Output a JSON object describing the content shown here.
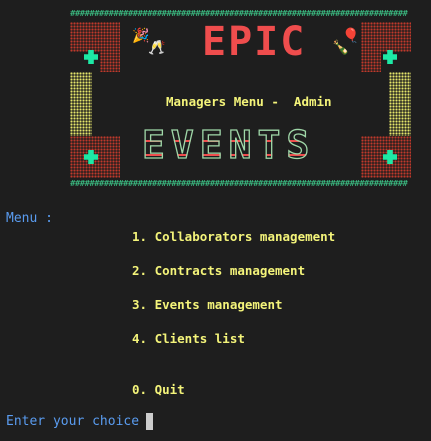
{
  "banner": {
    "top_hashes": "######################################################################",
    "bottom_hashes": "######################################################################",
    "logo_top": "EPIC",
    "logo_bottom": "EVENTS",
    "subtitle": "Managers Menu -  Admin",
    "left_icon": "party-popper-icon",
    "right_icon": "champagne-icon",
    "colors": {
      "hash": "#3ecf8e",
      "logo_red": "#ef4d4d",
      "tile": "#1de9a5",
      "dots_red": "#c0392b",
      "dots_yellow": "#e6e66a",
      "subtitle": "#f4f47a"
    }
  },
  "menu": {
    "header": "Menu :",
    "items": [
      {
        "label": "1. Collaborators management"
      },
      {
        "label": "2. Contracts management"
      },
      {
        "label": "3. Events management"
      },
      {
        "label": "4. Clients list"
      },
      {
        "label": "0. Quit"
      }
    ]
  },
  "prompt": {
    "text": "Enter your choice : "
  },
  "colors": {
    "background": "#1e1e1e",
    "label_blue": "#5a9cf0",
    "item_yellow": "#f4f47a",
    "cursor": "#cccccc"
  }
}
